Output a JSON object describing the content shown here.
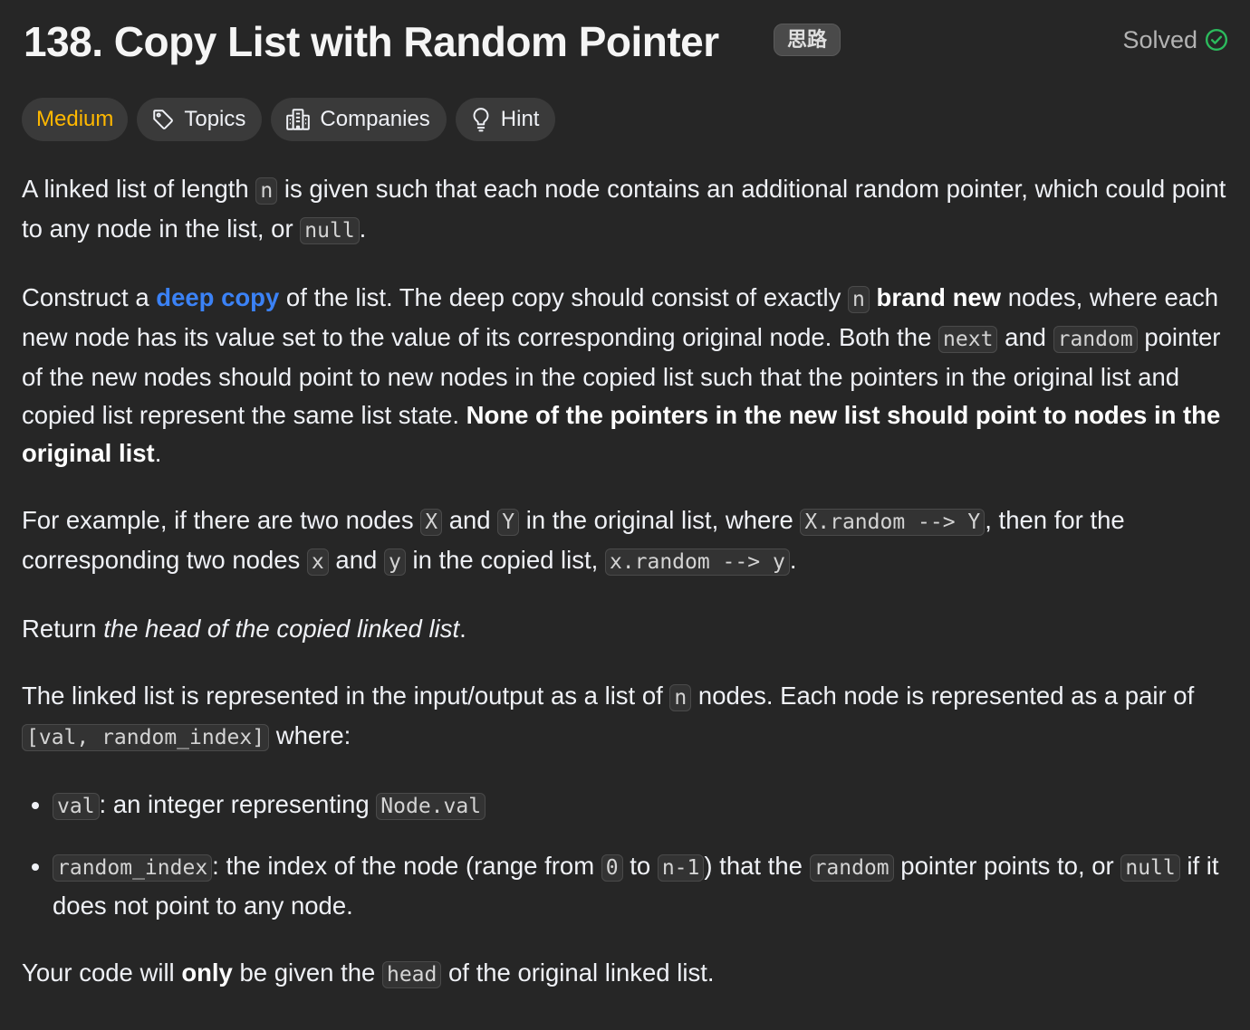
{
  "problem": {
    "title": "138. Copy List with Random Pointer",
    "tag_badge": "思路",
    "status": "Solved"
  },
  "chips": {
    "difficulty": "Medium",
    "topics": "Topics",
    "companies": "Companies",
    "hint": "Hint"
  },
  "colors": {
    "difficulty": "#ffb800",
    "solved_check": "#2cbb5d",
    "link": "#3b82f6"
  },
  "icons": [
    "tag-icon",
    "building-icon",
    "lightbulb-icon",
    "check-circle-icon"
  ],
  "p1": {
    "t1": "A linked list of length ",
    "c1": "n",
    "t2": " is given such that each node contains an additional random pointer, which could point to any node in the list, or ",
    "c2": "null",
    "t3": "."
  },
  "p2": {
    "t1": "Construct a ",
    "link": "deep copy",
    "t2": " of the list. The deep copy should consist of exactly ",
    "c1": "n",
    "t3": " ",
    "b1": "brand new",
    "t4": " nodes, where each new node has its value set to the value of its corresponding original node. Both the ",
    "c2": "next",
    "t5": " and ",
    "c3": "random",
    "t6": " pointer of the new nodes should point to new nodes in the copied list such that the pointers in the original list and copied list represent the same list state. ",
    "b2": "None of the pointers in the new list should point to nodes in the original list",
    "t7": "."
  },
  "p3": {
    "t1": "For example, if there are two nodes ",
    "c1": "X",
    "t2": " and ",
    "c2": "Y",
    "t3": " in the original list, where ",
    "c3": "X.random --> Y",
    "t4": ", then for the corresponding two nodes ",
    "c4": "x",
    "t5": " and ",
    "c5": "y",
    "t6": " in the copied list, ",
    "c6": "x.random --> y",
    "t7": "."
  },
  "p4": {
    "t1": "Return ",
    "i1": "the head of the copied linked list",
    "t2": "."
  },
  "p5": {
    "t1": "The linked list is represented in the input/output as a list of ",
    "c1": "n",
    "t2": " nodes. Each node is represented as a pair of ",
    "c2": "[val, random_index]",
    "t3": " where:"
  },
  "list": {
    "item1": {
      "c1": "val",
      "t1": ": an integer representing ",
      "c2": "Node.val"
    },
    "item2": {
      "c1": "random_index",
      "t1": ": the index of the node (range from ",
      "c2": "0",
      "t2": " to ",
      "c3": "n-1",
      "t3": ") that the ",
      "c4": "random",
      "t4": " pointer points to, or ",
      "c5": "null",
      "t5": " if it does not point to any node."
    }
  },
  "p6": {
    "t1": "Your code will ",
    "b1": "only",
    "t2": " be given the ",
    "c1": "head",
    "t3": " of the original linked list."
  }
}
